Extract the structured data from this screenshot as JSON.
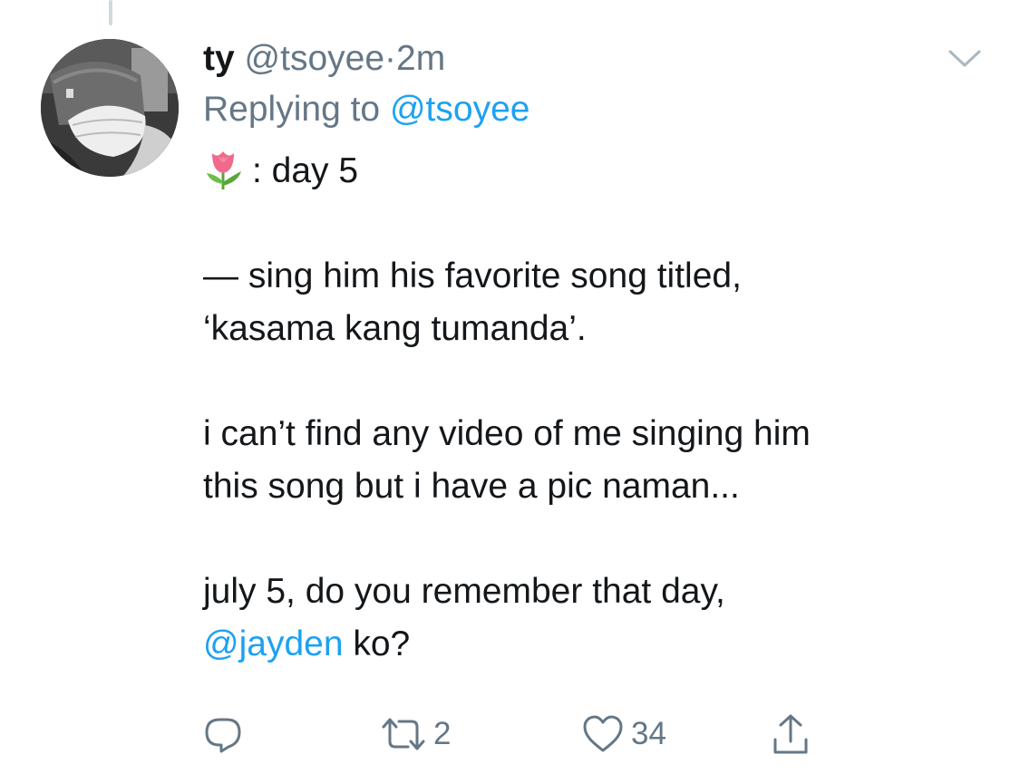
{
  "tweet": {
    "display_name": "ty",
    "handle": "@tsoyee",
    "separator": "·",
    "time": "2m",
    "replying_prefix": "Replying to",
    "replying_handle": "@tsoyee",
    "emoji": "tulip",
    "line1_suffix": ": day 5",
    "para2_line1": "— sing him his favorite song titled,",
    "para2_line2": "‘kasama kang tumanda’.",
    "para3_line1": "i can’t find any video of me singing him",
    "para3_line2": "this song but i have a pic naman...",
    "para4_line1": "july 5, do you remember that day,",
    "mention": "@jayden",
    "mention_suffix": " ko?"
  },
  "actions": {
    "reply_icon": "reply-icon",
    "retweet_icon": "retweet-icon",
    "retweet_count": "2",
    "like_icon": "heart-icon",
    "like_count": "34",
    "share_icon": "share-icon"
  },
  "colors": {
    "text": "#14171a",
    "secondary": "#657786",
    "link": "#1da1f2",
    "thread_line": "#cfd9de"
  }
}
